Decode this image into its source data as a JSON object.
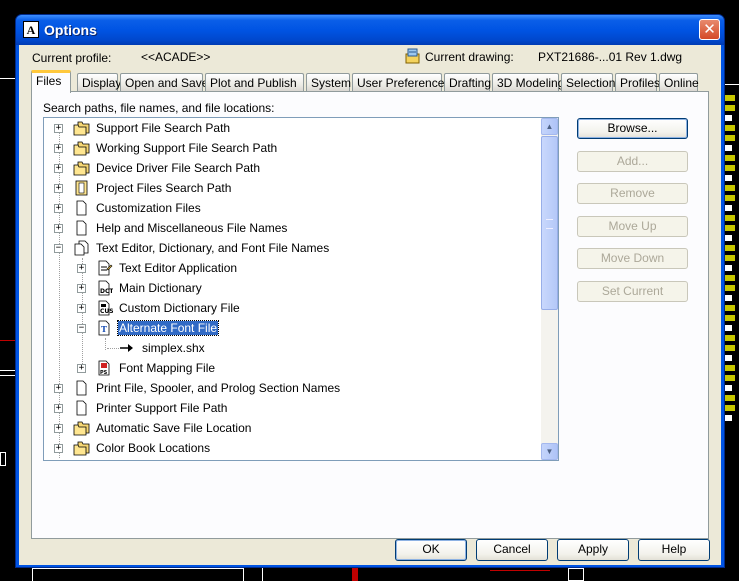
{
  "window": {
    "title": "Options"
  },
  "profile": {
    "label": "Current profile:",
    "value": "<<ACADE>>"
  },
  "drawing": {
    "label": "Current drawing:",
    "value": "PXT21686-...01 Rev 1.dwg"
  },
  "tabs": [
    {
      "label": "Files"
    },
    {
      "label": "Display"
    },
    {
      "label": "Open and Save"
    },
    {
      "label": "Plot and Publish"
    },
    {
      "label": "System"
    },
    {
      "label": "User Preferences"
    },
    {
      "label": "Drafting"
    },
    {
      "label": "3D Modeling"
    },
    {
      "label": "Selection"
    },
    {
      "label": "Profiles"
    },
    {
      "label": "Online"
    }
  ],
  "panel": {
    "caption": "Search paths, file names, and file locations:"
  },
  "tree": [
    {
      "label": "Support File Search Path",
      "icon": "folders-icon",
      "expander": "+"
    },
    {
      "label": "Working Support File Search Path",
      "icon": "folders-icon",
      "expander": "+"
    },
    {
      "label": "Device Driver File Search Path",
      "icon": "folders-icon",
      "expander": "+"
    },
    {
      "label": "Project Files Search Path",
      "icon": "project-icon",
      "expander": "+"
    },
    {
      "label": "Customization Files",
      "icon": "file-icon",
      "expander": "+"
    },
    {
      "label": "Help and Miscellaneous File Names",
      "icon": "file-icon",
      "expander": "+"
    },
    {
      "label": "Text Editor, Dictionary, and Font File Names",
      "icon": "files-icon",
      "expander": "−"
    },
    {
      "label": "Text Editor Application",
      "icon": "edit-file-icon",
      "expander": "+"
    },
    {
      "label": "Main Dictionary",
      "icon": "dictionary-icon",
      "expander": "+"
    },
    {
      "label": "Custom Dictionary File",
      "icon": "custom-dictionary-icon",
      "expander": "+"
    },
    {
      "label": "Alternate Font File",
      "icon": "font-file-icon",
      "expander": "−"
    },
    {
      "label": "simplex.shx",
      "icon": "arrow-icon",
      "expander": ""
    },
    {
      "label": "Font Mapping File",
      "icon": "font-mapping-icon",
      "expander": "+"
    },
    {
      "label": "Print File, Spooler, and Prolog Section Names",
      "icon": "file-icon",
      "expander": "+"
    },
    {
      "label": "Printer Support File Path",
      "icon": "file-icon",
      "expander": "+"
    },
    {
      "label": "Automatic Save File Location",
      "icon": "folders-icon",
      "expander": "+"
    },
    {
      "label": "Color Book Locations",
      "icon": "folders-icon",
      "expander": "+"
    }
  ],
  "side_buttons": {
    "browse": "Browse...",
    "add": "Add...",
    "remove": "Remove",
    "move_up": "Move Up",
    "move_down": "Move Down",
    "set_current": "Set Current"
  },
  "footer": {
    "ok": "OK",
    "cancel": "Cancel",
    "apply": "Apply",
    "help": "Help"
  },
  "colors": {
    "title_bar": "#0054e3",
    "selection": "#316ac5",
    "active_tab_accent": "#ffc83c"
  }
}
